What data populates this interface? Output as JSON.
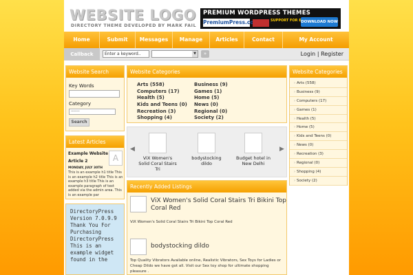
{
  "header": {
    "logo": "WEBSITE LOGO",
    "tagline": "DIRECTORY THEME DEVELOPED BY MARK FAIL",
    "banner": {
      "headline": "PREMIUM WORDPRESS THEMES",
      "brand": "PremiumPress.com",
      "support": "SUPPORT FOR EXTRA PLUGINS",
      "cta": "DOWNLOAD NOW"
    }
  },
  "nav": [
    "Home",
    "Submit",
    "Messages",
    "Manage",
    "Articles",
    "Contact",
    "My Account"
  ],
  "subbar": {
    "callback": "Callback",
    "keyword_value": "Enter a keyword..",
    "login": "Login",
    "separator": "|",
    "register": "Register"
  },
  "search": {
    "title": "Website Search",
    "keywords_label": "Key Words",
    "category_label": "Category",
    "category_value": "-------",
    "button": "Search"
  },
  "articles": {
    "title": "Latest Articles",
    "item1": "Example Website",
    "item2": "Article 2",
    "date": "MONDAY, JULY 30TH",
    "text": "This is an example h1 title This is an example h2 title This is an example h3 title This is an example paragraph of text added via the admin area. This is an example par"
  },
  "widget": {
    "text": "DirectoryPress Version 7.0.9.9 Thank You For Purchasing DirectoryPress This is an example widget found in the"
  },
  "categories": {
    "title": "Website Categories",
    "col1": [
      "Arts (558)",
      "Computers (17)",
      "Health (5)",
      "Kids and Teens (0)",
      "Recreation (3)",
      "Shopping (4)"
    ],
    "col2": [
      "Business (9)",
      "Games (1)",
      "Home (5)",
      "News (0)",
      "Regional (0)",
      "Society (2)"
    ]
  },
  "slider": {
    "items": [
      "ViX Women's Solid Coral Stairs Tri",
      "bodystocking dildo",
      "Budget hotel in New Delhi"
    ]
  },
  "recent": {
    "title": "Recently Added Listings",
    "listings": [
      {
        "title": "ViX Women's Solid Coral Stairs Tri Bikini Top Coral Red",
        "desc": "ViX Women's Solid Coral Stairs Tri Bikini Top Coral Red"
      },
      {
        "title": "bodystocking dildo",
        "desc": "Top Quality Vibrators Available online, Realistic Vibrators, Sex Toys for Ladies or Cheap Dildo we have got all. Visit our Sex toy shop for ultimate shopping pleasure ."
      }
    ]
  },
  "right_categories": {
    "title": "Website Categories",
    "items": [
      "Arts (558)",
      "Business (9)",
      "Computers (17)",
      "Games (1)",
      "Health (5)",
      "Home (5)",
      "Kids and Teens (0)",
      "News (0)",
      "Recreation (3)",
      "Regional (0)",
      "Shopping (4)",
      "Society (2)"
    ]
  },
  "colors": {
    "accent": "#f5a000",
    "background_top": "#ffe04a",
    "background_bottom": "#ff9a00"
  }
}
